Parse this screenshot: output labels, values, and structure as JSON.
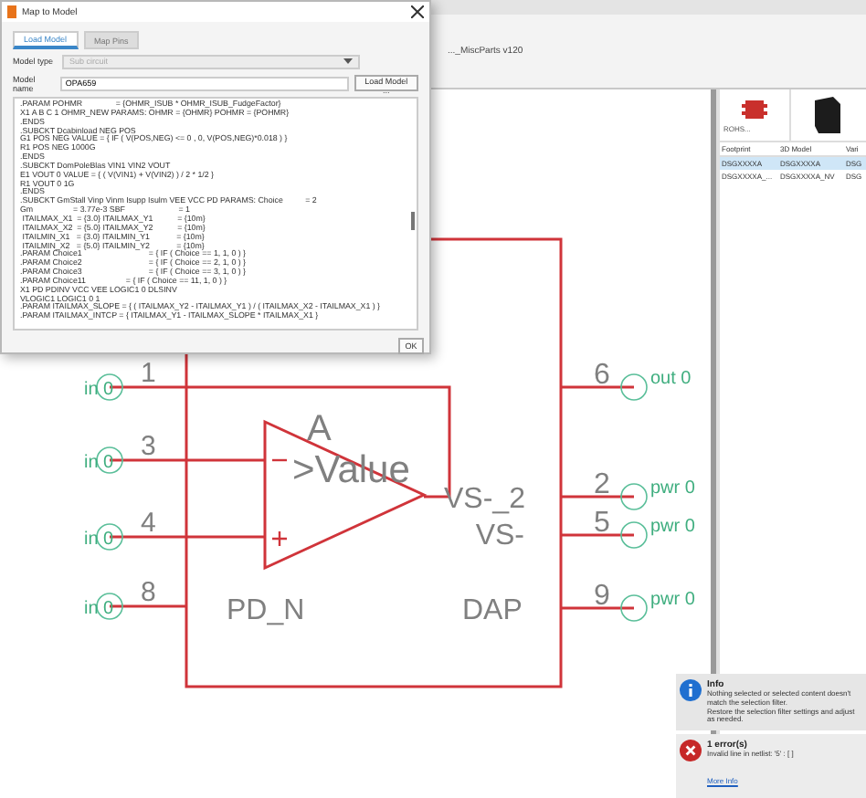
{
  "app": {
    "title": "..._MiscParts v120"
  },
  "dialog": {
    "title": "Map to Model",
    "tabs": [
      {
        "label": "Load Model",
        "selected": true
      },
      {
        "label": "Map Pins",
        "selected": false
      }
    ],
    "model_type": {
      "label": "Model type",
      "value": "Sub circuit",
      "disabled": true
    },
    "model_name": {
      "label": "Model name",
      "value": "OPA659"
    },
    "load_button": "Load Model ...",
    "netlist": [
      ".PARAM POHMR               = {OHMR_ISUB * OHMR_ISUB_FudgeFactor}",
      "X1 A B C 1 OHMR_NEW PARAMS: OHMR = {OHMR} POHMR = {POHMR}",
      ".ENDS",
      ".SUBCKT Dcabinload NEG POS",
      "G1 POS NEG VALUE = { IF ( V(POS,NEG) <= 0 , 0, V(POS,NEG)*0.018 ) }",
      "R1 POS NEG 1000G",
      ".ENDS",
      ".SUBCKT DomPoleBlas VIN1 VIN2 VOUT",
      "E1 VOUT 0 VALUE = { ( V(VIN1) + V(VIN2) ) / 2 * 1/2 }",
      "R1 VOUT 0 1G",
      ".ENDS",
      ".SUBCKT GmStall Vinp Vinm Isupp Isulm VEE VCC PD PARAMS: Choice          = 2",
      "Gm                  = 3.77e-3 SBF                        = 1",
      " ITAILMAX_X1  = {3.0} ITAILMAX_Y1           = {10m}",
      " ITAILMAX_X2  = {5.0} ITAILMAX_Y2           = {10m}",
      " ITAILMIN_X1   = {3.0} ITAILMIN_Y1            = {10m}",
      " ITAILMIN_X2   = {5.0} ITAILMIN_Y2            = {10m}",
      ".PARAM Choice1                              = { IF ( Choice == 1, 1, 0 ) }",
      ".PARAM Choice2                              = { IF ( Choice == 2, 1, 0 ) }",
      ".PARAM Choice3                              = { IF ( Choice == 3, 1, 0 ) }",
      ".PARAM Choice11                  = { IF ( Choice == 11, 1, 0 ) }",
      "X1 PD PDINV VCC VEE LOGIC1 0 DLSINV",
      "VLOGIC1 LOGIC1 0 1",
      ".PARAM ITAILMAX_SLOPE = { ( ITAILMAX_Y2 - ITAILMAX_Y1 ) / ( ITAILMAX_X2 - ITAILMAX_X1 ) }",
      ".PARAM ITAILMAX_INTCP = { ITAILMAX_Y1 - ITAILMAX_SLOPE * ITAILMAX_X1 }"
    ],
    "ok_button": "OK"
  },
  "schematic": {
    "symbol_name": "A",
    "value": ">Value",
    "left_pins": [
      {
        "number": "1",
        "net": "in 0"
      },
      {
        "number": "3",
        "net": "in 0"
      },
      {
        "number": "4",
        "net": "in 0"
      },
      {
        "number": "8",
        "net": "in 0"
      }
    ],
    "right_pins": [
      {
        "number": "6",
        "net": "out 0"
      },
      {
        "number": "2",
        "net": "pwr 0"
      },
      {
        "number": "5",
        "net": "pwr 0"
      },
      {
        "number": "9",
        "net": "pwr 0"
      }
    ],
    "pin_labels": [
      "VS-_2",
      "VS-",
      "PD_N",
      "DAP"
    ]
  },
  "side_panel": {
    "preview_caption": "ROHS...",
    "columns": [
      "Footprint",
      "3D Model",
      "Vari"
    ],
    "rows": [
      {
        "cells": [
          "DSGXXXXA",
          "DSGXXXXA",
          "DSG"
        ],
        "selected": true
      },
      {
        "cells": [
          "DSGXXXXA_...",
          "DSGXXXXA_NV",
          "DSG"
        ],
        "selected": false
      }
    ]
  },
  "notifications": [
    {
      "kind": "info",
      "title": "Info",
      "lines": [
        "Nothing selected or selected content doesn't match the selection filter.",
        "Restore the selection filter settings and adjust as needed."
      ]
    },
    {
      "kind": "error",
      "title": "1 error(s)",
      "lines": [
        "Invalid line in netlist: '5' : [ ]"
      ],
      "link": "More Info"
    }
  ]
}
